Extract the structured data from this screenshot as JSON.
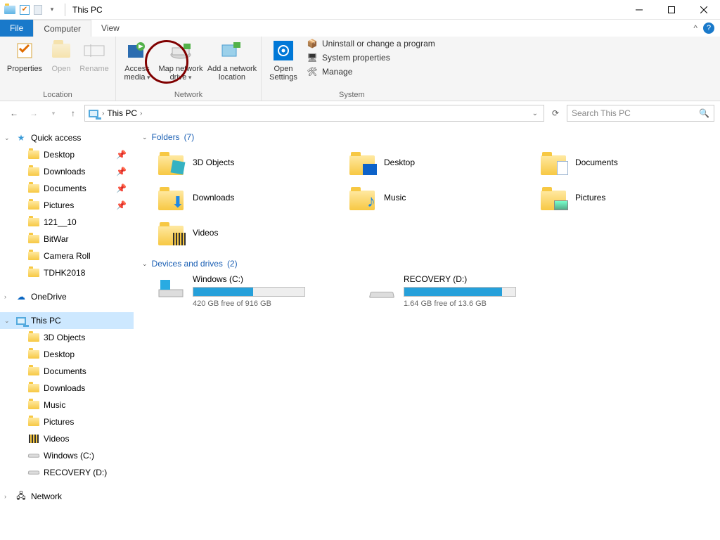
{
  "title": "This PC",
  "tabs": {
    "file": "File",
    "computer": "Computer",
    "view": "View"
  },
  "ribbon": {
    "location": {
      "label": "Location",
      "properties": "Properties",
      "open": "Open",
      "rename": "Rename"
    },
    "network": {
      "label": "Network",
      "access_media": "Access media",
      "map_drive": "Map network drive",
      "add_location": "Add a network location"
    },
    "system": {
      "label": "System",
      "open_settings": "Open Settings",
      "uninstall": "Uninstall or change a program",
      "properties": "System properties",
      "manage": "Manage"
    }
  },
  "address": {
    "crumb": "This PC"
  },
  "search": {
    "placeholder": "Search This PC"
  },
  "nav": {
    "quick": "Quick access",
    "quick_items": [
      {
        "label": "Desktop",
        "pin": true
      },
      {
        "label": "Downloads",
        "pin": true
      },
      {
        "label": "Documents",
        "pin": true
      },
      {
        "label": "Pictures",
        "pin": true
      },
      {
        "label": "121__10",
        "pin": false
      },
      {
        "label": "BitWar",
        "pin": false
      },
      {
        "label": "Camera Roll",
        "pin": false
      },
      {
        "label": "TDHK2018",
        "pin": false
      }
    ],
    "onedrive": "OneDrive",
    "thispc": "This PC",
    "thispc_items": [
      "3D Objects",
      "Desktop",
      "Documents",
      "Downloads",
      "Music",
      "Pictures",
      "Videos",
      "Windows (C:)",
      "RECOVERY (D:)"
    ],
    "network": "Network"
  },
  "sections": {
    "folders": {
      "label": "Folders",
      "count": "(7)"
    },
    "drives": {
      "label": "Devices and drives",
      "count": "(2)"
    }
  },
  "folders": [
    "3D Objects",
    "Desktop",
    "Documents",
    "Downloads",
    "Music",
    "Pictures",
    "Videos"
  ],
  "drives": [
    {
      "name": "Windows (C:)",
      "free": "420 GB free of 916 GB",
      "fill_pct": 54
    },
    {
      "name": "RECOVERY (D:)",
      "free": "1.64 GB free of 13.6 GB",
      "fill_pct": 88
    }
  ]
}
